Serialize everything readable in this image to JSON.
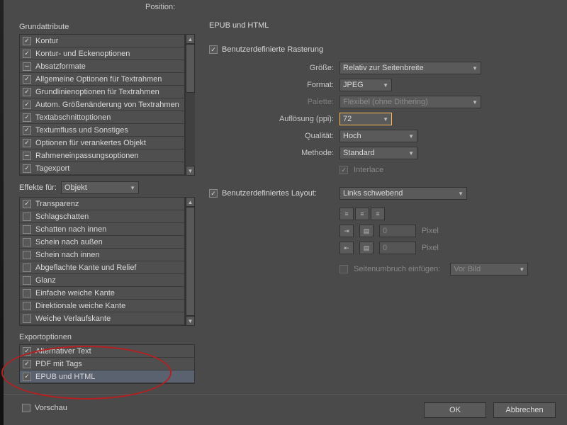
{
  "topLabel": "Position:",
  "left": {
    "grundattribute": {
      "title": "Grundattribute",
      "items": [
        {
          "checked": true,
          "label": "Kontur"
        },
        {
          "checked": true,
          "label": "Kontur- und Eckenoptionen"
        },
        {
          "dash": true,
          "label": "Absatzformate"
        },
        {
          "checked": true,
          "label": "Allgemeine Optionen für Textrahmen"
        },
        {
          "checked": true,
          "label": "Grundlinienoptionen für Textrahmen"
        },
        {
          "checked": true,
          "label": "Autom. Größenänderung von Textrahmen"
        },
        {
          "checked": true,
          "label": "Textabschnittoptionen"
        },
        {
          "checked": true,
          "label": "Textumfluss und Sonstiges"
        },
        {
          "checked": true,
          "label": "Optionen für verankertes Objekt"
        },
        {
          "dash": true,
          "label": "Rahmeneinpassungsoptionen"
        },
        {
          "checked": true,
          "label": "Tagexport"
        }
      ]
    },
    "effekte": {
      "label": "Effekte für:",
      "value": "Objekt",
      "items": [
        {
          "checked": true,
          "label": "Transparenz"
        },
        {
          "checked": false,
          "label": "Schlagschatten"
        },
        {
          "checked": false,
          "label": "Schatten nach innen"
        },
        {
          "checked": false,
          "label": "Schein nach außen"
        },
        {
          "checked": false,
          "label": "Schein nach innen"
        },
        {
          "checked": false,
          "label": "Abgeflachte Kante und Relief"
        },
        {
          "checked": false,
          "label": "Glanz"
        },
        {
          "checked": false,
          "label": "Einfache weiche Kante"
        },
        {
          "checked": false,
          "label": "Direktionale weiche Kante"
        },
        {
          "checked": false,
          "label": "Weiche Verlaufskante"
        }
      ]
    },
    "export": {
      "title": "Exportoptionen",
      "items": [
        {
          "checked": true,
          "label": "Alternativer Text"
        },
        {
          "checked": true,
          "label": "PDF mit Tags"
        },
        {
          "checked": true,
          "label": "EPUB und HTML",
          "selected": true
        }
      ]
    }
  },
  "right": {
    "heading": "EPUB und HTML",
    "raster": {
      "cb": "Benutzerdefinierte Rasterung",
      "cb_checked": true,
      "groesse": {
        "label": "Größe:",
        "value": "Relativ zur Seitenbreite"
      },
      "format": {
        "label": "Format:",
        "value": "JPEG"
      },
      "palette": {
        "label": "Palette:",
        "value": "Flexibel (ohne Dithering)"
      },
      "aufloesung": {
        "label": "Auflösung (ppi):",
        "value": "72"
      },
      "qualitaet": {
        "label": "Qualität:",
        "value": "Hoch"
      },
      "methode": {
        "label": "Methode:",
        "value": "Standard"
      },
      "interlace": {
        "label": "Interlace",
        "checked": true
      }
    },
    "layout": {
      "cb": "Benutzerdefiniertes Layout:",
      "cb_checked": true,
      "value": "Links schwebend",
      "spacing1": "0",
      "spacing2": "0",
      "pixel": "Pixel",
      "pagebreak": {
        "label": "Seitenumbruch einfügen:",
        "value": "Vor Bild"
      }
    }
  },
  "bottom": {
    "vorschau": "Vorschau",
    "ok": "OK",
    "cancel": "Abbrechen"
  }
}
